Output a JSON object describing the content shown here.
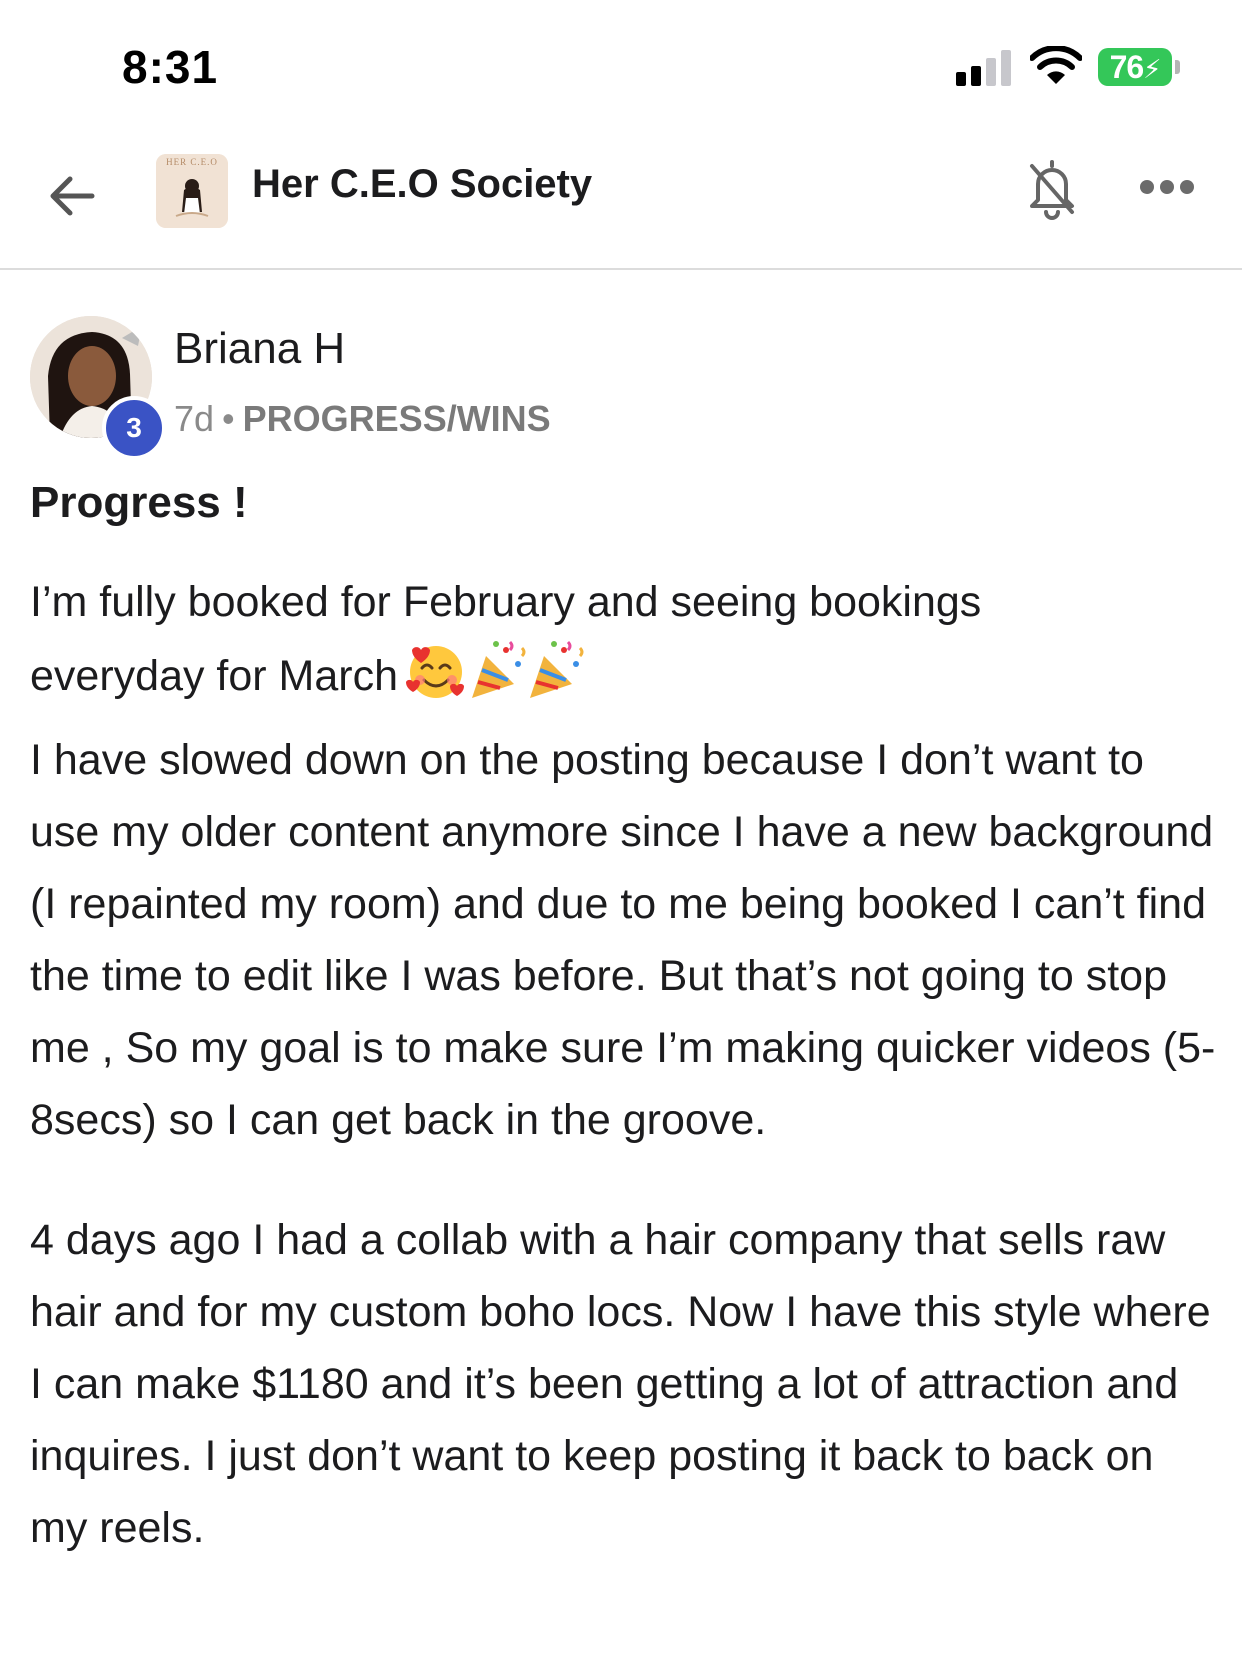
{
  "status_bar": {
    "time": "8:31",
    "battery": "76"
  },
  "header": {
    "back_icon": "arrow-left-icon",
    "group_logo_text": "HER C.E.O",
    "group_name": "Her C.E.O Society",
    "bell_icon": "bell-off-icon",
    "more_icon": "more-horizontal-icon"
  },
  "post": {
    "author": "Briana H",
    "level": "3",
    "age": "7d",
    "separator": "•",
    "category": "PROGRESS/WINS",
    "title": "Progress !",
    "line1": "I’m fully booked for February and seeing bookings",
    "line2": "everyday for March",
    "emojis": [
      "smiling-face-with-hearts",
      "party-popper",
      "party-popper"
    ],
    "paragraph1_rest": "I have slowed down on the posting because I don’t want to use my older content anymore since I have a new background (I repainted my room) and due to me being booked I can’t find the time to edit like I was before. But that’s not going to stop me , So my goal is to make sure I’m making quicker videos (5-8secs) so I can get back in the groove.",
    "paragraph2": "4 days ago I had a collab with a hair company that sells raw hair and for my custom boho locs. Now I have this style where I can make $1180 and it’s been getting a lot of attraction and inquires. I just don’t want to keep posting it back to back on my reels."
  },
  "colors": {
    "battery_green": "#34c759",
    "level_badge_blue": "#3a53c5",
    "meta_gray": "#8a8a8a"
  }
}
